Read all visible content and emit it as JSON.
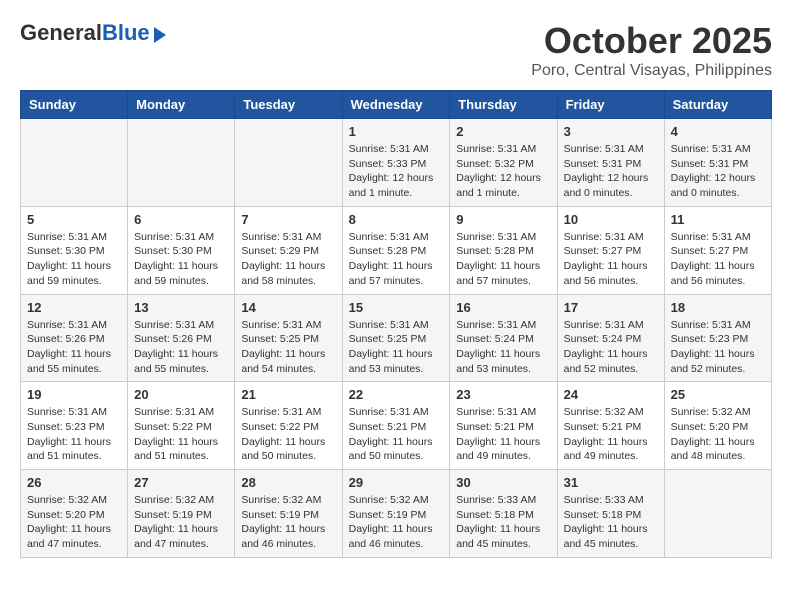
{
  "header": {
    "logo_general": "General",
    "logo_blue": "Blue",
    "month": "October 2025",
    "location": "Poro, Central Visayas, Philippines"
  },
  "weekdays": [
    "Sunday",
    "Monday",
    "Tuesday",
    "Wednesday",
    "Thursday",
    "Friday",
    "Saturday"
  ],
  "weeks": [
    [
      {
        "day": "",
        "sunrise": "",
        "sunset": "",
        "daylight": ""
      },
      {
        "day": "",
        "sunrise": "",
        "sunset": "",
        "daylight": ""
      },
      {
        "day": "",
        "sunrise": "",
        "sunset": "",
        "daylight": ""
      },
      {
        "day": "1",
        "sunrise": "Sunrise: 5:31 AM",
        "sunset": "Sunset: 5:33 PM",
        "daylight": "Daylight: 12 hours and 1 minute."
      },
      {
        "day": "2",
        "sunrise": "Sunrise: 5:31 AM",
        "sunset": "Sunset: 5:32 PM",
        "daylight": "Daylight: 12 hours and 1 minute."
      },
      {
        "day": "3",
        "sunrise": "Sunrise: 5:31 AM",
        "sunset": "Sunset: 5:31 PM",
        "daylight": "Daylight: 12 hours and 0 minutes."
      },
      {
        "day": "4",
        "sunrise": "Sunrise: 5:31 AM",
        "sunset": "Sunset: 5:31 PM",
        "daylight": "Daylight: 12 hours and 0 minutes."
      }
    ],
    [
      {
        "day": "5",
        "sunrise": "Sunrise: 5:31 AM",
        "sunset": "Sunset: 5:30 PM",
        "daylight": "Daylight: 11 hours and 59 minutes."
      },
      {
        "day": "6",
        "sunrise": "Sunrise: 5:31 AM",
        "sunset": "Sunset: 5:30 PM",
        "daylight": "Daylight: 11 hours and 59 minutes."
      },
      {
        "day": "7",
        "sunrise": "Sunrise: 5:31 AM",
        "sunset": "Sunset: 5:29 PM",
        "daylight": "Daylight: 11 hours and 58 minutes."
      },
      {
        "day": "8",
        "sunrise": "Sunrise: 5:31 AM",
        "sunset": "Sunset: 5:28 PM",
        "daylight": "Daylight: 11 hours and 57 minutes."
      },
      {
        "day": "9",
        "sunrise": "Sunrise: 5:31 AM",
        "sunset": "Sunset: 5:28 PM",
        "daylight": "Daylight: 11 hours and 57 minutes."
      },
      {
        "day": "10",
        "sunrise": "Sunrise: 5:31 AM",
        "sunset": "Sunset: 5:27 PM",
        "daylight": "Daylight: 11 hours and 56 minutes."
      },
      {
        "day": "11",
        "sunrise": "Sunrise: 5:31 AM",
        "sunset": "Sunset: 5:27 PM",
        "daylight": "Daylight: 11 hours and 56 minutes."
      }
    ],
    [
      {
        "day": "12",
        "sunrise": "Sunrise: 5:31 AM",
        "sunset": "Sunset: 5:26 PM",
        "daylight": "Daylight: 11 hours and 55 minutes."
      },
      {
        "day": "13",
        "sunrise": "Sunrise: 5:31 AM",
        "sunset": "Sunset: 5:26 PM",
        "daylight": "Daylight: 11 hours and 55 minutes."
      },
      {
        "day": "14",
        "sunrise": "Sunrise: 5:31 AM",
        "sunset": "Sunset: 5:25 PM",
        "daylight": "Daylight: 11 hours and 54 minutes."
      },
      {
        "day": "15",
        "sunrise": "Sunrise: 5:31 AM",
        "sunset": "Sunset: 5:25 PM",
        "daylight": "Daylight: 11 hours and 53 minutes."
      },
      {
        "day": "16",
        "sunrise": "Sunrise: 5:31 AM",
        "sunset": "Sunset: 5:24 PM",
        "daylight": "Daylight: 11 hours and 53 minutes."
      },
      {
        "day": "17",
        "sunrise": "Sunrise: 5:31 AM",
        "sunset": "Sunset: 5:24 PM",
        "daylight": "Daylight: 11 hours and 52 minutes."
      },
      {
        "day": "18",
        "sunrise": "Sunrise: 5:31 AM",
        "sunset": "Sunset: 5:23 PM",
        "daylight": "Daylight: 11 hours and 52 minutes."
      }
    ],
    [
      {
        "day": "19",
        "sunrise": "Sunrise: 5:31 AM",
        "sunset": "Sunset: 5:23 PM",
        "daylight": "Daylight: 11 hours and 51 minutes."
      },
      {
        "day": "20",
        "sunrise": "Sunrise: 5:31 AM",
        "sunset": "Sunset: 5:22 PM",
        "daylight": "Daylight: 11 hours and 51 minutes."
      },
      {
        "day": "21",
        "sunrise": "Sunrise: 5:31 AM",
        "sunset": "Sunset: 5:22 PM",
        "daylight": "Daylight: 11 hours and 50 minutes."
      },
      {
        "day": "22",
        "sunrise": "Sunrise: 5:31 AM",
        "sunset": "Sunset: 5:21 PM",
        "daylight": "Daylight: 11 hours and 50 minutes."
      },
      {
        "day": "23",
        "sunrise": "Sunrise: 5:31 AM",
        "sunset": "Sunset: 5:21 PM",
        "daylight": "Daylight: 11 hours and 49 minutes."
      },
      {
        "day": "24",
        "sunrise": "Sunrise: 5:32 AM",
        "sunset": "Sunset: 5:21 PM",
        "daylight": "Daylight: 11 hours and 49 minutes."
      },
      {
        "day": "25",
        "sunrise": "Sunrise: 5:32 AM",
        "sunset": "Sunset: 5:20 PM",
        "daylight": "Daylight: 11 hours and 48 minutes."
      }
    ],
    [
      {
        "day": "26",
        "sunrise": "Sunrise: 5:32 AM",
        "sunset": "Sunset: 5:20 PM",
        "daylight": "Daylight: 11 hours and 47 minutes."
      },
      {
        "day": "27",
        "sunrise": "Sunrise: 5:32 AM",
        "sunset": "Sunset: 5:19 PM",
        "daylight": "Daylight: 11 hours and 47 minutes."
      },
      {
        "day": "28",
        "sunrise": "Sunrise: 5:32 AM",
        "sunset": "Sunset: 5:19 PM",
        "daylight": "Daylight: 11 hours and 46 minutes."
      },
      {
        "day": "29",
        "sunrise": "Sunrise: 5:32 AM",
        "sunset": "Sunset: 5:19 PM",
        "daylight": "Daylight: 11 hours and 46 minutes."
      },
      {
        "day": "30",
        "sunrise": "Sunrise: 5:33 AM",
        "sunset": "Sunset: 5:18 PM",
        "daylight": "Daylight: 11 hours and 45 minutes."
      },
      {
        "day": "31",
        "sunrise": "Sunrise: 5:33 AM",
        "sunset": "Sunset: 5:18 PM",
        "daylight": "Daylight: 11 hours and 45 minutes."
      },
      {
        "day": "",
        "sunrise": "",
        "sunset": "",
        "daylight": ""
      }
    ]
  ]
}
